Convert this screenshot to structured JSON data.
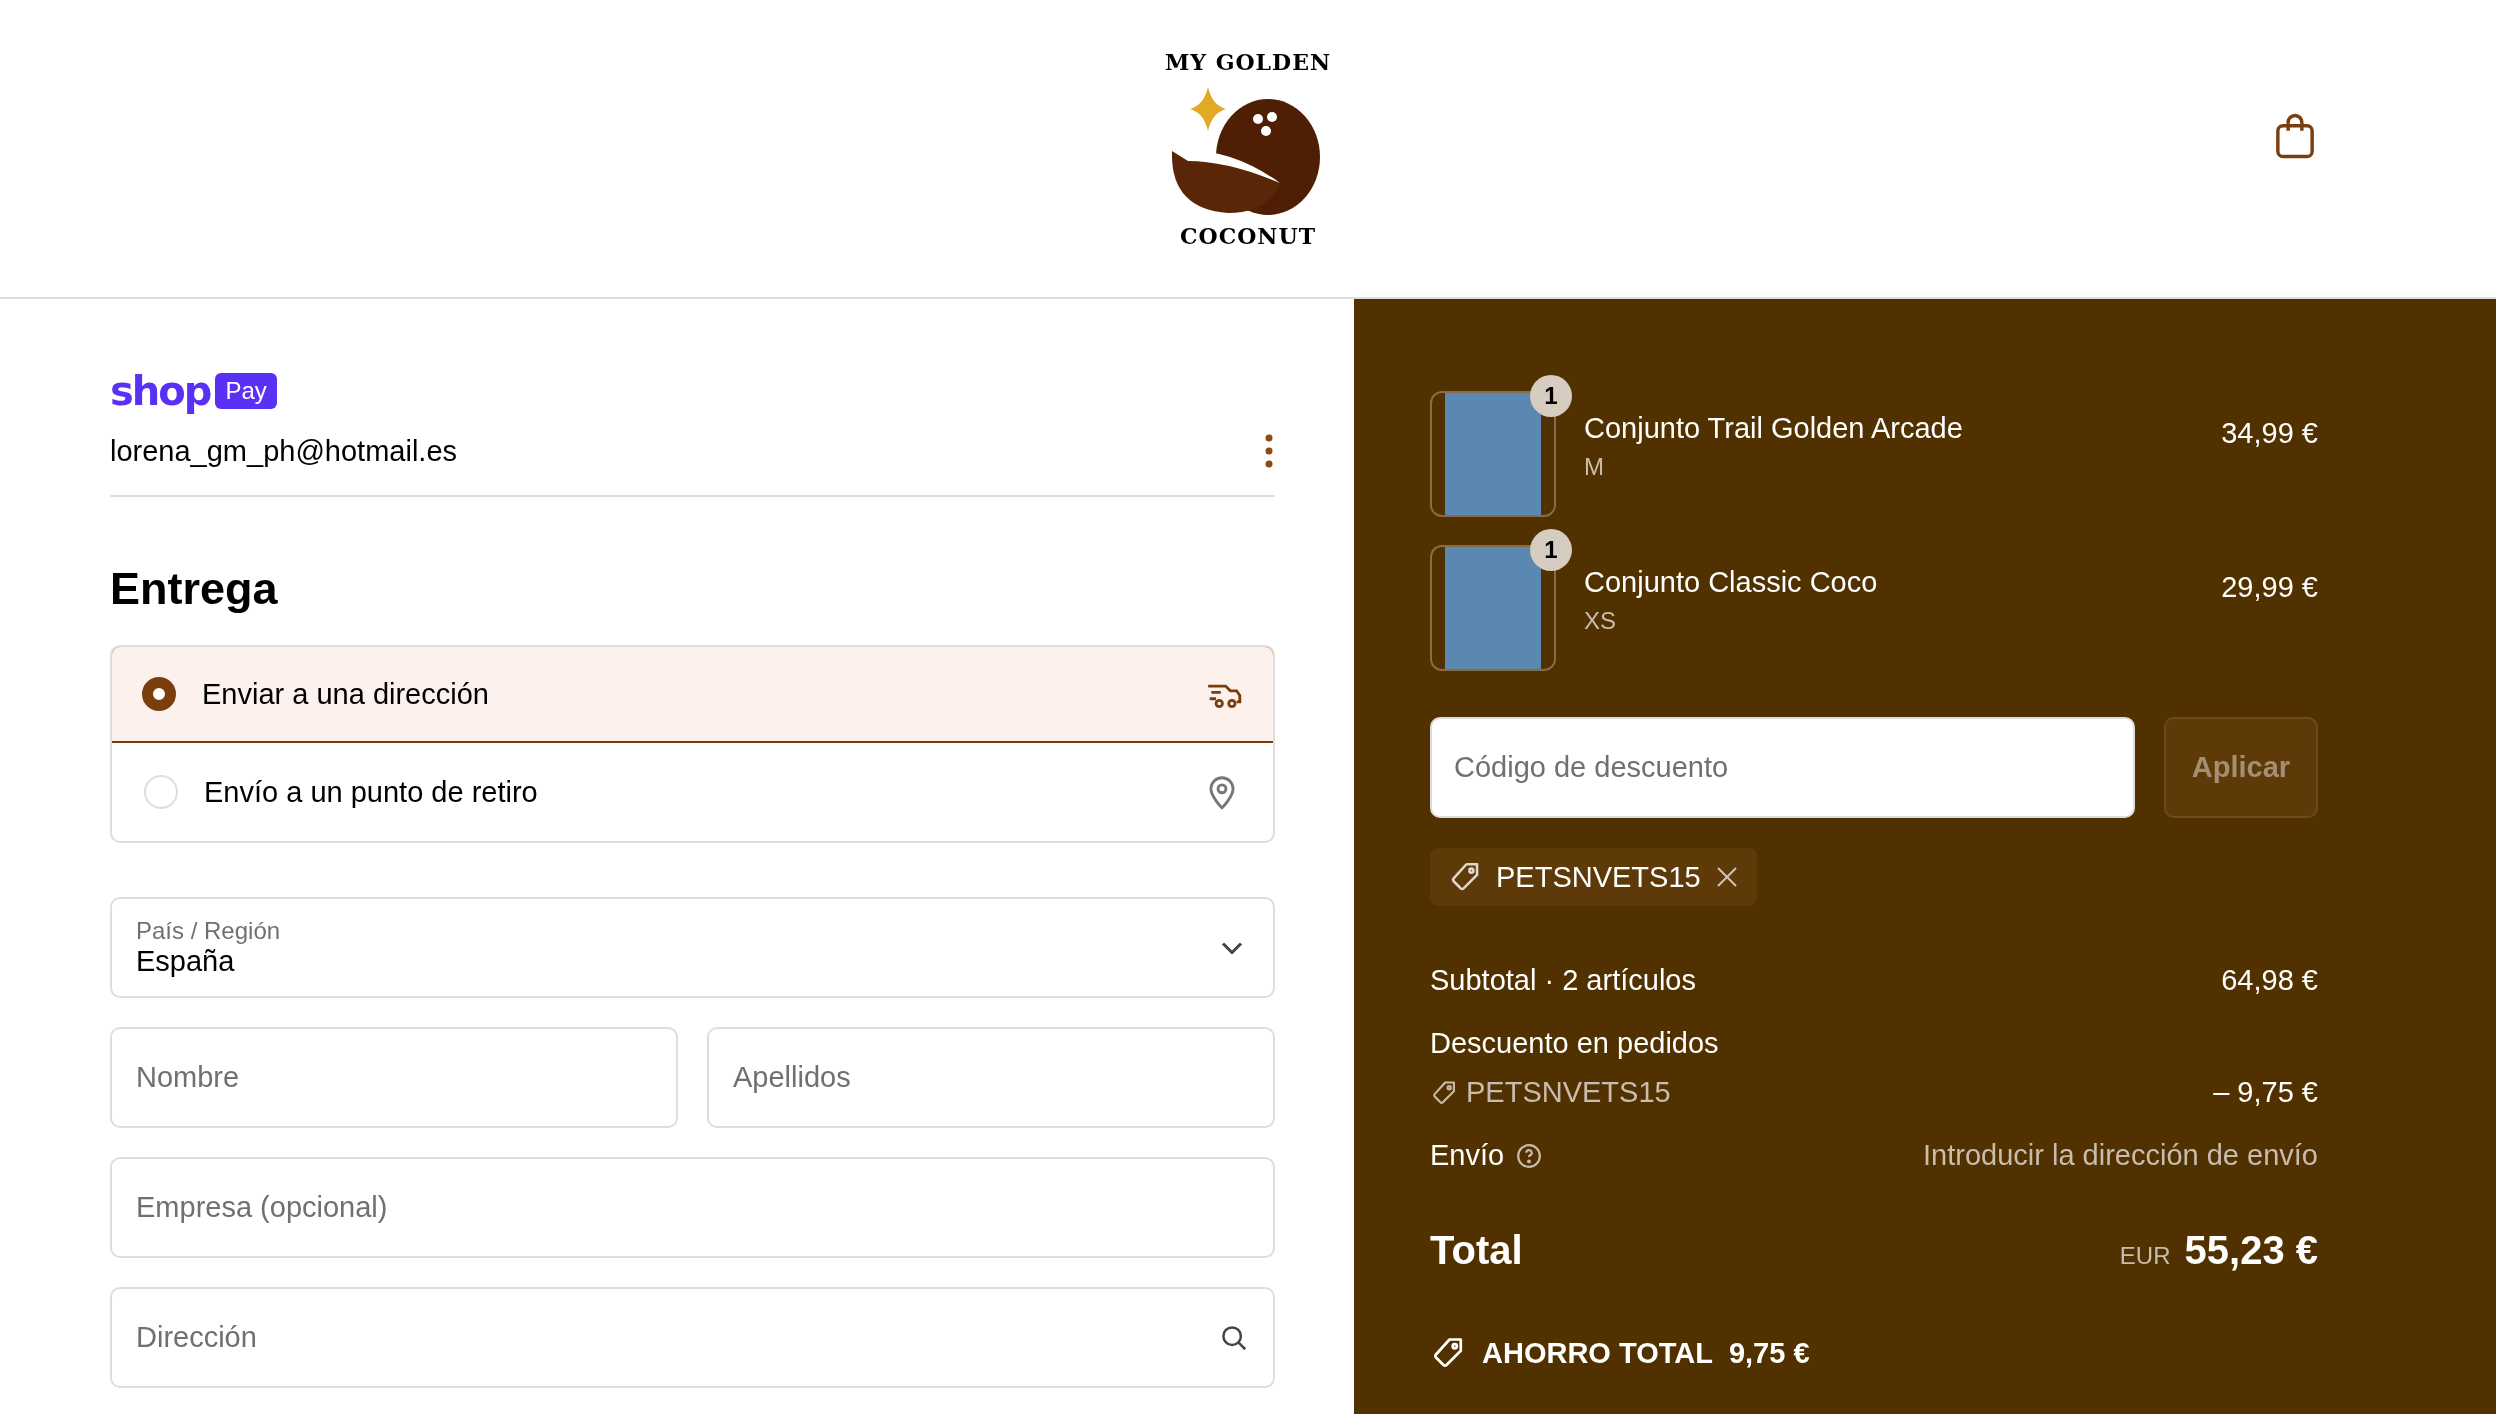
{
  "header": {
    "logo": {
      "top_text": "MY GOLDEN",
      "bottom_text": "COCONUT"
    }
  },
  "shop_pay": {
    "brand": "shop",
    "badge": "Pay",
    "email": "lorena_gm_ph@hotmail.es"
  },
  "delivery": {
    "title": "Entrega",
    "options": [
      {
        "label": "Enviar a una dirección",
        "kind": "ship",
        "selected": true
      },
      {
        "label": "Envío a un punto de retiro",
        "kind": "pickup",
        "selected": false
      }
    ]
  },
  "form_rows": [
    [
      {
        "kind": "select",
        "label": "País / Región",
        "value": "España"
      }
    ],
    [
      {
        "kind": "text",
        "placeholder": "Nombre"
      },
      {
        "kind": "text",
        "placeholder": "Apellidos"
      }
    ],
    [
      {
        "kind": "text",
        "placeholder": "Empresa (opcional)"
      }
    ],
    [
      {
        "kind": "search",
        "placeholder": "Dirección"
      }
    ]
  ],
  "order": {
    "items": [
      {
        "name": "Conjunto Trail Golden Arcade",
        "variant": "M",
        "price": "34,99 €",
        "quantity": "1"
      },
      {
        "name": "Conjunto Classic Coco",
        "variant": "XS",
        "price": "29,99 €",
        "quantity": "1"
      }
    ],
    "discount": {
      "placeholder": "Código de descuento",
      "button": "Aplicar",
      "disabled": true
    },
    "applied_codes": [
      {
        "code": "PETSNVETS15"
      }
    ],
    "subtotal": {
      "label": "Subtotal · 2 artículos",
      "value": "64,98 €"
    },
    "order_discount": {
      "label": "Descuento en pedidos",
      "code": "PETSNVETS15",
      "value": "– 9,75 €"
    },
    "shipping": {
      "label": "Envío",
      "value": "Introducir la dirección de envío"
    },
    "total": {
      "label": "Total",
      "currency": "EUR",
      "value": "55,23 €"
    },
    "savings": {
      "label": "AHORRO TOTAL",
      "value": "9,75 €"
    }
  }
}
